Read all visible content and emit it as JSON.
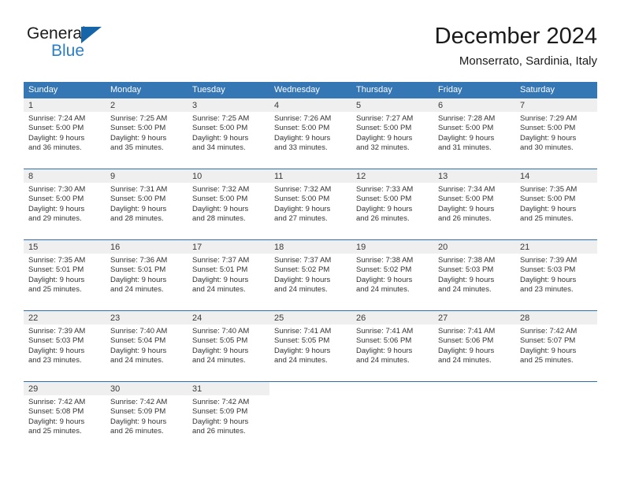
{
  "brand": {
    "name_part1": "General",
    "name_part2": "Blue",
    "triangle_color": "#1565a8",
    "blue_text_color": "#2b7fc4"
  },
  "header": {
    "month_title": "December 2024",
    "location": "Monserrato, Sardinia, Italy"
  },
  "theme": {
    "header_row_bg": "#3576b5",
    "week_separator": "#2f6fae",
    "daynum_band_bg": "#efefef",
    "text_color": "#333333"
  },
  "weekday_headers": [
    "Sunday",
    "Monday",
    "Tuesday",
    "Wednesday",
    "Thursday",
    "Friday",
    "Saturday"
  ],
  "weeks": [
    [
      {
        "day": "1",
        "sunrise": "Sunrise: 7:24 AM",
        "sunset": "Sunset: 5:00 PM",
        "daylight1": "Daylight: 9 hours",
        "daylight2": "and 36 minutes."
      },
      {
        "day": "2",
        "sunrise": "Sunrise: 7:25 AM",
        "sunset": "Sunset: 5:00 PM",
        "daylight1": "Daylight: 9 hours",
        "daylight2": "and 35 minutes."
      },
      {
        "day": "3",
        "sunrise": "Sunrise: 7:25 AM",
        "sunset": "Sunset: 5:00 PM",
        "daylight1": "Daylight: 9 hours",
        "daylight2": "and 34 minutes."
      },
      {
        "day": "4",
        "sunrise": "Sunrise: 7:26 AM",
        "sunset": "Sunset: 5:00 PM",
        "daylight1": "Daylight: 9 hours",
        "daylight2": "and 33 minutes."
      },
      {
        "day": "5",
        "sunrise": "Sunrise: 7:27 AM",
        "sunset": "Sunset: 5:00 PM",
        "daylight1": "Daylight: 9 hours",
        "daylight2": "and 32 minutes."
      },
      {
        "day": "6",
        "sunrise": "Sunrise: 7:28 AM",
        "sunset": "Sunset: 5:00 PM",
        "daylight1": "Daylight: 9 hours",
        "daylight2": "and 31 minutes."
      },
      {
        "day": "7",
        "sunrise": "Sunrise: 7:29 AM",
        "sunset": "Sunset: 5:00 PM",
        "daylight1": "Daylight: 9 hours",
        "daylight2": "and 30 minutes."
      }
    ],
    [
      {
        "day": "8",
        "sunrise": "Sunrise: 7:30 AM",
        "sunset": "Sunset: 5:00 PM",
        "daylight1": "Daylight: 9 hours",
        "daylight2": "and 29 minutes."
      },
      {
        "day": "9",
        "sunrise": "Sunrise: 7:31 AM",
        "sunset": "Sunset: 5:00 PM",
        "daylight1": "Daylight: 9 hours",
        "daylight2": "and 28 minutes."
      },
      {
        "day": "10",
        "sunrise": "Sunrise: 7:32 AM",
        "sunset": "Sunset: 5:00 PM",
        "daylight1": "Daylight: 9 hours",
        "daylight2": "and 28 minutes."
      },
      {
        "day": "11",
        "sunrise": "Sunrise: 7:32 AM",
        "sunset": "Sunset: 5:00 PM",
        "daylight1": "Daylight: 9 hours",
        "daylight2": "and 27 minutes."
      },
      {
        "day": "12",
        "sunrise": "Sunrise: 7:33 AM",
        "sunset": "Sunset: 5:00 PM",
        "daylight1": "Daylight: 9 hours",
        "daylight2": "and 26 minutes."
      },
      {
        "day": "13",
        "sunrise": "Sunrise: 7:34 AM",
        "sunset": "Sunset: 5:00 PM",
        "daylight1": "Daylight: 9 hours",
        "daylight2": "and 26 minutes."
      },
      {
        "day": "14",
        "sunrise": "Sunrise: 7:35 AM",
        "sunset": "Sunset: 5:00 PM",
        "daylight1": "Daylight: 9 hours",
        "daylight2": "and 25 minutes."
      }
    ],
    [
      {
        "day": "15",
        "sunrise": "Sunrise: 7:35 AM",
        "sunset": "Sunset: 5:01 PM",
        "daylight1": "Daylight: 9 hours",
        "daylight2": "and 25 minutes."
      },
      {
        "day": "16",
        "sunrise": "Sunrise: 7:36 AM",
        "sunset": "Sunset: 5:01 PM",
        "daylight1": "Daylight: 9 hours",
        "daylight2": "and 24 minutes."
      },
      {
        "day": "17",
        "sunrise": "Sunrise: 7:37 AM",
        "sunset": "Sunset: 5:01 PM",
        "daylight1": "Daylight: 9 hours",
        "daylight2": "and 24 minutes."
      },
      {
        "day": "18",
        "sunrise": "Sunrise: 7:37 AM",
        "sunset": "Sunset: 5:02 PM",
        "daylight1": "Daylight: 9 hours",
        "daylight2": "and 24 minutes."
      },
      {
        "day": "19",
        "sunrise": "Sunrise: 7:38 AM",
        "sunset": "Sunset: 5:02 PM",
        "daylight1": "Daylight: 9 hours",
        "daylight2": "and 24 minutes."
      },
      {
        "day": "20",
        "sunrise": "Sunrise: 7:38 AM",
        "sunset": "Sunset: 5:03 PM",
        "daylight1": "Daylight: 9 hours",
        "daylight2": "and 24 minutes."
      },
      {
        "day": "21",
        "sunrise": "Sunrise: 7:39 AM",
        "sunset": "Sunset: 5:03 PM",
        "daylight1": "Daylight: 9 hours",
        "daylight2": "and 23 minutes."
      }
    ],
    [
      {
        "day": "22",
        "sunrise": "Sunrise: 7:39 AM",
        "sunset": "Sunset: 5:03 PM",
        "daylight1": "Daylight: 9 hours",
        "daylight2": "and 23 minutes."
      },
      {
        "day": "23",
        "sunrise": "Sunrise: 7:40 AM",
        "sunset": "Sunset: 5:04 PM",
        "daylight1": "Daylight: 9 hours",
        "daylight2": "and 24 minutes."
      },
      {
        "day": "24",
        "sunrise": "Sunrise: 7:40 AM",
        "sunset": "Sunset: 5:05 PM",
        "daylight1": "Daylight: 9 hours",
        "daylight2": "and 24 minutes."
      },
      {
        "day": "25",
        "sunrise": "Sunrise: 7:41 AM",
        "sunset": "Sunset: 5:05 PM",
        "daylight1": "Daylight: 9 hours",
        "daylight2": "and 24 minutes."
      },
      {
        "day": "26",
        "sunrise": "Sunrise: 7:41 AM",
        "sunset": "Sunset: 5:06 PM",
        "daylight1": "Daylight: 9 hours",
        "daylight2": "and 24 minutes."
      },
      {
        "day": "27",
        "sunrise": "Sunrise: 7:41 AM",
        "sunset": "Sunset: 5:06 PM",
        "daylight1": "Daylight: 9 hours",
        "daylight2": "and 24 minutes."
      },
      {
        "day": "28",
        "sunrise": "Sunrise: 7:42 AM",
        "sunset": "Sunset: 5:07 PM",
        "daylight1": "Daylight: 9 hours",
        "daylight2": "and 25 minutes."
      }
    ],
    [
      {
        "day": "29",
        "sunrise": "Sunrise: 7:42 AM",
        "sunset": "Sunset: 5:08 PM",
        "daylight1": "Daylight: 9 hours",
        "daylight2": "and 25 minutes."
      },
      {
        "day": "30",
        "sunrise": "Sunrise: 7:42 AM",
        "sunset": "Sunset: 5:09 PM",
        "daylight1": "Daylight: 9 hours",
        "daylight2": "and 26 minutes."
      },
      {
        "day": "31",
        "sunrise": "Sunrise: 7:42 AM",
        "sunset": "Sunset: 5:09 PM",
        "daylight1": "Daylight: 9 hours",
        "daylight2": "and 26 minutes."
      },
      {
        "day": "",
        "sunrise": "",
        "sunset": "",
        "daylight1": "",
        "daylight2": ""
      },
      {
        "day": "",
        "sunrise": "",
        "sunset": "",
        "daylight1": "",
        "daylight2": ""
      },
      {
        "day": "",
        "sunrise": "",
        "sunset": "",
        "daylight1": "",
        "daylight2": ""
      },
      {
        "day": "",
        "sunrise": "",
        "sunset": "",
        "daylight1": "",
        "daylight2": ""
      }
    ]
  ]
}
